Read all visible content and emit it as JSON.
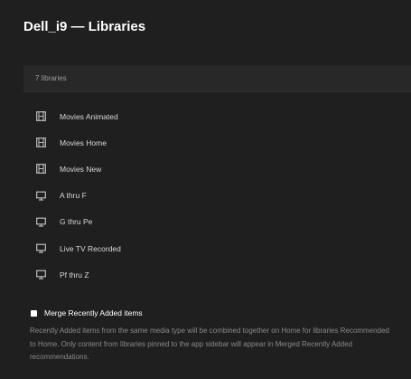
{
  "header": {
    "title": "Dell_i9 — Libraries"
  },
  "libraries": {
    "count_label": "7 libraries",
    "items": [
      {
        "label": "Movies Animated",
        "icon": "film-icon"
      },
      {
        "label": "Movies Home",
        "icon": "film-icon"
      },
      {
        "label": "Movies New",
        "icon": "film-icon"
      },
      {
        "label": "A thru F",
        "icon": "tv-icon"
      },
      {
        "label": "G thru Pe",
        "icon": "tv-icon"
      },
      {
        "label": "Live TV Recorded",
        "icon": "tv-icon"
      },
      {
        "label": "Pf thru Z",
        "icon": "tv-icon"
      }
    ]
  },
  "merge": {
    "label": "Merge Recently Added items",
    "checked": false,
    "description": "Recently Added items from the same media type will be combined together on Home for libraries Recommended to Home. Only content from libraries pinned to the app sidebar will appear in Merged Recently Added recommendations."
  }
}
